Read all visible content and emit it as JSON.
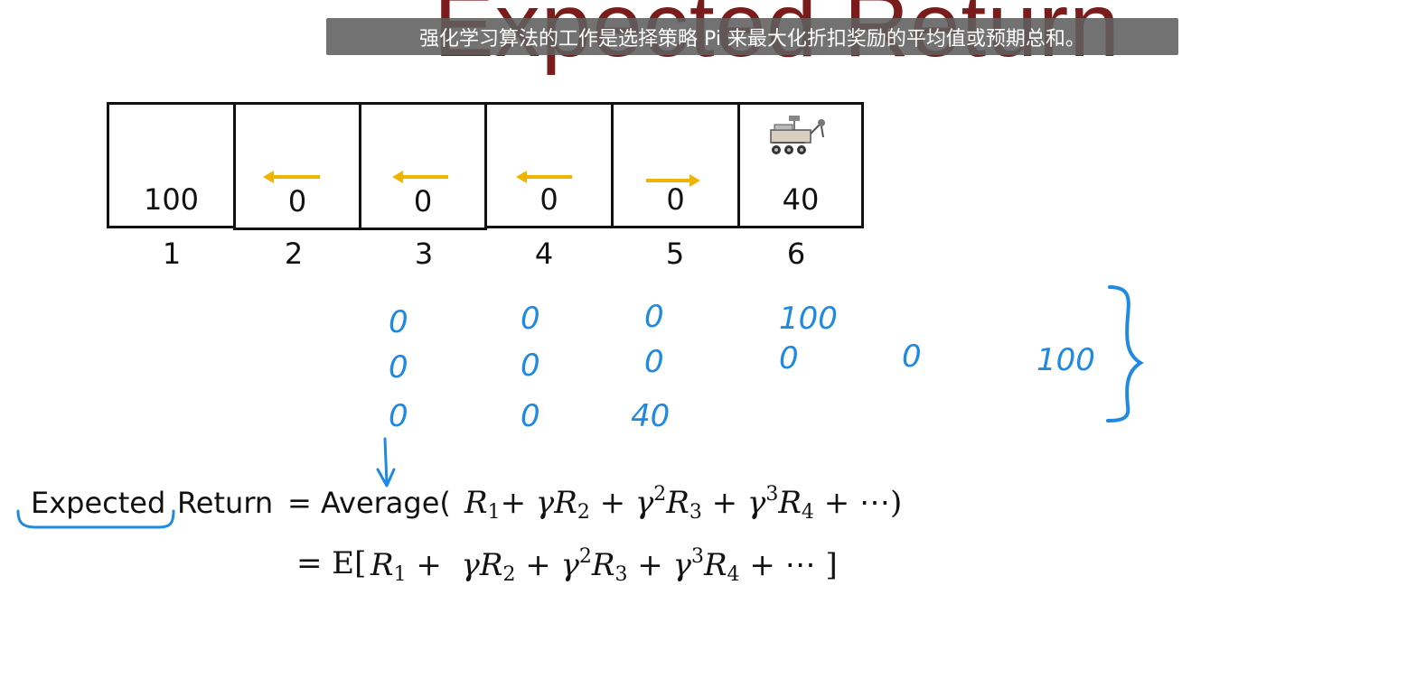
{
  "slide": {
    "title": "Expected Return",
    "caption": "强化学习算法的工作是选择策略 Pi 来最大化折扣奖励的平均值或预期总和。"
  },
  "grid": {
    "rewards": [
      "100",
      "0",
      "0",
      "0",
      "0",
      "40"
    ],
    "states": [
      "1",
      "2",
      "3",
      "4",
      "5",
      "6"
    ],
    "arrows": [
      "",
      "left",
      "left",
      "left",
      "right",
      ""
    ],
    "arrow_color": "#f0b400"
  },
  "annotations": {
    "color": "#1f8ae0",
    "row1": [
      "0",
      "0",
      "0",
      "100"
    ],
    "row2": [
      "0",
      "0",
      "0",
      "0",
      "0",
      "100"
    ],
    "row3": [
      "0",
      "0",
      "40"
    ]
  },
  "equation": {
    "line1_prefix": "Expected",
    "line1_word": "Return",
    "line1_eq": "= Average(",
    "line2_prefix": "= E["
  }
}
